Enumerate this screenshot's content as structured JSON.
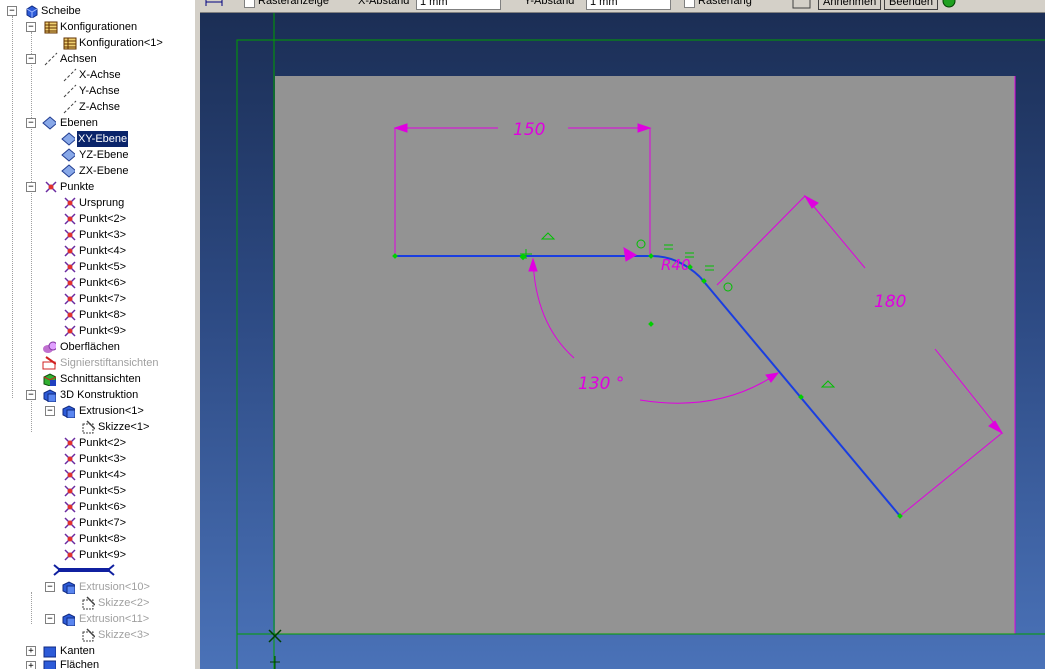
{
  "tree": {
    "root": "Scheibe",
    "konfigurationen": "Konfigurationen",
    "konfiguration1": "Konfiguration<1>",
    "achsen": "Achsen",
    "x_achse": "X-Achse",
    "y_achse": "Y-Achse",
    "z_achse": "Z-Achse",
    "ebenen": "Ebenen",
    "xy_ebene": "XY-Ebene",
    "yz_ebene": "YZ-Ebene",
    "zx_ebene": "ZX-Ebene",
    "punkte": "Punkte",
    "punkte_items": [
      "Ursprung",
      "Punkt<2>",
      "Punkt<3>",
      "Punkt<4>",
      "Punkt<5>",
      "Punkt<6>",
      "Punkt<7>",
      "Punkt<8>",
      "Punkt<9>"
    ],
    "oberflaechen": "Oberflächen",
    "signierstiftansichten": "Signierstiftansichten",
    "schnittansichten": "Schnittansichten",
    "konstruktion_3d": "3D Konstruktion",
    "extrusion1": "Extrusion<1>",
    "skizze1": "Skizze<1>",
    "konstruktion_punkte": [
      "Punkt<2>",
      "Punkt<3>",
      "Punkt<4>",
      "Punkt<5>",
      "Punkt<6>",
      "Punkt<7>",
      "Punkt<8>",
      "Punkt<9>"
    ],
    "extrusion10": "Extrusion<10>",
    "skizze2": "Skizze<2>",
    "extrusion11": "Extrusion<11>",
    "skizze3": "Skizze<3>",
    "kanten": "Kanten",
    "flaechen": "Flächen"
  },
  "toolbar": {
    "rasteranzeige_label": "Rasteranzeige",
    "x_abstand_label": "X-Abstand",
    "x_abstand_value": "1 mm",
    "y_abstand_label": "Y-Abstand",
    "y_abstand_value": "1 mm",
    "rasterfang_label": "Rasterfang",
    "annehmen_label": "Annehmen",
    "beenden_label": "Beenden"
  },
  "sketch": {
    "dim_horizontal": "150",
    "dim_angle": "130 °",
    "dim_radius": "R40",
    "dim_slanted": "180"
  },
  "colors": {
    "viewport_top": "#1b2e55",
    "viewport_bottom": "#4a72b8",
    "sketch_plane": "#939393",
    "sketch_line": "#1a3ee0",
    "dimension": "#e000e0",
    "constraint": "#00c000",
    "frame": "#00a000",
    "selection": "#0a246a"
  }
}
